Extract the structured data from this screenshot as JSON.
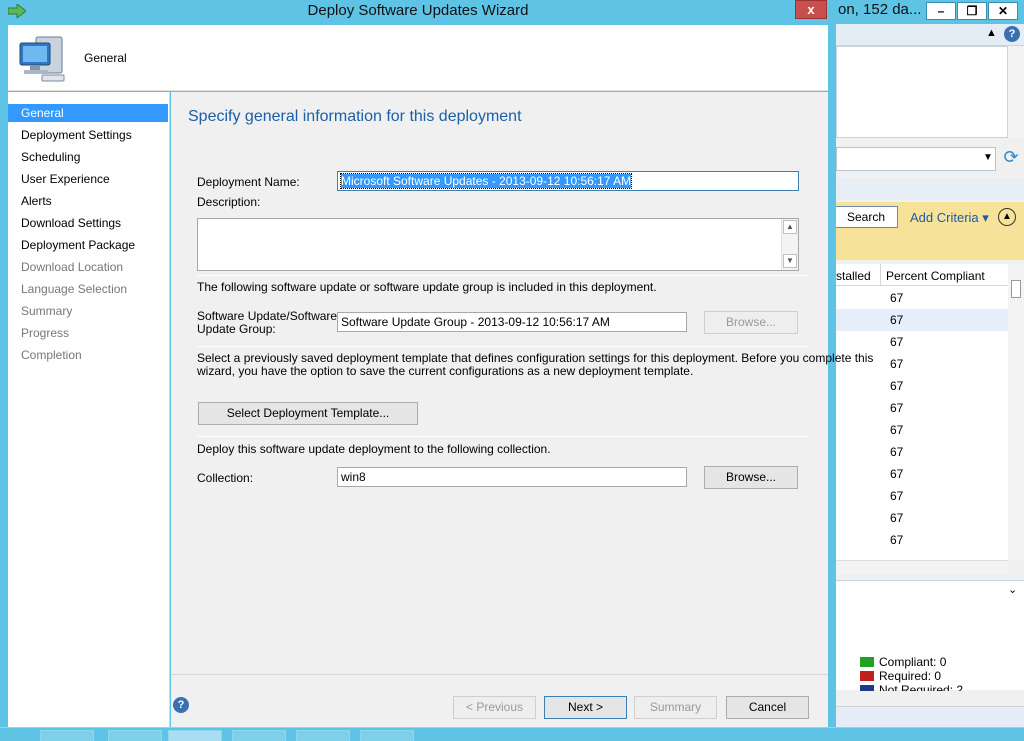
{
  "wizard": {
    "title": "Deploy Software Updates Wizard",
    "close_label": "x",
    "header_title": "General",
    "nav": [
      {
        "label": "General",
        "state": "active"
      },
      {
        "label": "Deployment Settings",
        "state": "enabled"
      },
      {
        "label": "Scheduling",
        "state": "enabled"
      },
      {
        "label": "User Experience",
        "state": "enabled"
      },
      {
        "label": "Alerts",
        "state": "enabled"
      },
      {
        "label": "Download Settings",
        "state": "enabled"
      },
      {
        "label": "Deployment Package",
        "state": "enabled"
      },
      {
        "label": "Download Location",
        "state": "disabled"
      },
      {
        "label": "Language Selection",
        "state": "disabled"
      },
      {
        "label": "Summary",
        "state": "disabled"
      },
      {
        "label": "Progress",
        "state": "disabled"
      },
      {
        "label": "Completion",
        "state": "disabled"
      }
    ],
    "content": {
      "heading": "Specify general information for this deployment",
      "deployment_name_label": "Deployment Name:",
      "deployment_name_value": "Microsoft Software Updates - 2013-09-12 10:56:17 AM",
      "description_label": "Description:",
      "description_value": "",
      "update_info_text": "The following software update or software update group is included in this deployment.",
      "update_group_label_line1": "Software Update/Software",
      "update_group_label_line2": "Update Group:",
      "update_group_value": "Software Update Group - 2013-09-12 10:56:17 AM",
      "browse_label": "Browse...",
      "template_text_line1": "Select a previously saved deployment template that defines configuration settings for this deployment. Before you complete this",
      "template_text_line2": "wizard, you have the option to save the current configurations as a new deployment template.",
      "select_template_label": "Select Deployment Template...",
      "collection_info_text": "Deploy this software update deployment to the following collection.",
      "collection_label": "Collection:",
      "collection_value": "win8",
      "collection_browse_label": "Browse..."
    },
    "footer": {
      "help_label": "?",
      "previous_label": "< Previous",
      "next_label": "Next >",
      "summary_label": "Summary",
      "cancel_label": "Cancel"
    }
  },
  "background_console": {
    "title_fragment": "on, 152 da...",
    "minimize_label": "–",
    "restore_label": "❐",
    "close_label": "✕",
    "search_label": "Search",
    "add_criteria_label": "Add Criteria ▾",
    "columns": [
      "stalled",
      "Percent Compliant"
    ],
    "rows": [
      "67",
      "67",
      "67",
      "67",
      "67",
      "67",
      "67",
      "67",
      "67",
      "67",
      "67",
      "67"
    ],
    "legend": [
      {
        "label": "Compliant: 0",
        "color": "#22a022"
      },
      {
        "label": "Required: 0",
        "color": "#c02020"
      },
      {
        "label": "Not Required: 2",
        "color": "#1f3a8a"
      }
    ]
  }
}
